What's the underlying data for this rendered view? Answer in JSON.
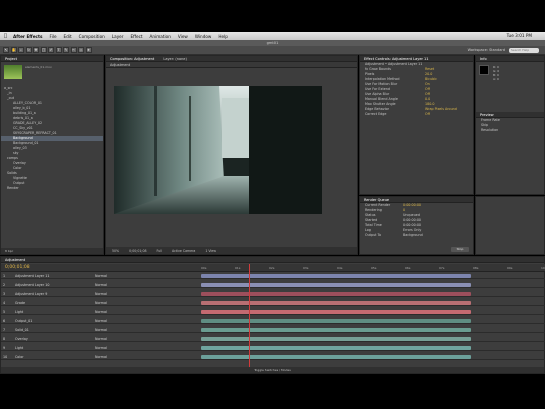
{
  "menubar": {
    "apple": "",
    "app": "After Effects",
    "items": [
      "File",
      "Edit",
      "Composition",
      "Layer",
      "Effect",
      "Animation",
      "View",
      "Window",
      "Help"
    ],
    "clock": "Tue 3:01 PM"
  },
  "window_title": "gmt01",
  "toolbar": {
    "tools": [
      "↖",
      "✋",
      "⌕",
      "↻",
      "✥",
      "□",
      "✐",
      "T",
      "✎",
      "✂",
      "◇",
      "★"
    ],
    "workspace_label": "Workspace:",
    "workspace_value": "Standard",
    "search_placeholder": "Search Help"
  },
  "project": {
    "tab": "Project",
    "folders": [
      "a_src",
      "_in",
      "_out",
      "comps",
      "Solids",
      "Render"
    ],
    "items": [
      "elements_01.mov",
      "ALLEY_COLOR_01",
      "alley_b_01",
      "building_01_a",
      "debris_01_a",
      "GRADE_ALLEY_02",
      "CC_Sky_v01",
      "SKYSCRAPER_REFRACT_01",
      "Background",
      "Background_01",
      "alley_03",
      "sky",
      "Overlay",
      "Color",
      "Vignette",
      "Output"
    ],
    "selected_index": 8,
    "footer": "8 bpc"
  },
  "composition": {
    "tabs": [
      "Composition: Adjustment",
      "Layer: (none)"
    ],
    "subtab": "Adjustment",
    "footer": [
      "50%",
      "0;00;01;08",
      "Full",
      "Active Camera",
      "1 View"
    ]
  },
  "effects": {
    "tab": "Effect Controls: Adjustment Layer 11",
    "rows": [
      {
        "label": "Adjustment • Adjustment Layer 11",
        "value": ""
      },
      {
        "label": "fx Grow Bounds",
        "value": "Reset"
      },
      {
        "label": "Pixels",
        "value": "20.0"
      },
      {
        "label": "Interpolation Method",
        "value": "Bicubic"
      },
      {
        "label": "Use For Motion Blur",
        "value": "On"
      },
      {
        "label": "Use For Extend",
        "value": "Off"
      },
      {
        "label": "Use Alpha Blur",
        "value": "Off"
      },
      {
        "label": "Manual Blend Angle",
        "value": "0.0"
      },
      {
        "label": "Max Shutter Angle",
        "value": "180.0"
      },
      {
        "label": "Edge Behavior",
        "value": "Wrap Pixels Around"
      },
      {
        "label": "Correct Edge",
        "value": "Off"
      }
    ]
  },
  "info": {
    "tab": "Info",
    "values": [
      "R: 0",
      "G: 0",
      "B: 0",
      "A: 0"
    ]
  },
  "preview": {
    "tab": "Preview",
    "values": [
      "Frame Rate",
      "Skip",
      "Resolution"
    ]
  },
  "render_panel": {
    "tab": "Render Queue",
    "rows": [
      {
        "label": "Current Render",
        "value": "0:00:00:00"
      },
      {
        "label": "Rendering",
        "value": "0"
      },
      {
        "label": "Status",
        "value": "Unqueued"
      },
      {
        "label": "Started",
        "value": "0:00:00:00"
      },
      {
        "label": "Total Time",
        "value": "0:00:00:00"
      },
      {
        "label": "Log",
        "value": "Errors Only"
      },
      {
        "label": "Output To",
        "value": "Background"
      }
    ],
    "button": "Stop"
  },
  "timeline": {
    "tab": "Adjustment",
    "timecode": "0;00;01;08",
    "ruler": [
      "00s",
      "01s",
      "02s",
      "03s",
      "04s",
      "05s",
      "06s",
      "07s",
      "08s",
      "09s",
      "10s"
    ],
    "playhead_fraction": 0.14,
    "layers": [
      {
        "num": "1",
        "name": "Adjustment Layer 11",
        "mode": "Normal",
        "color": "#7c84ad"
      },
      {
        "num": "2",
        "name": "Adjustment Layer 10",
        "mode": "Normal",
        "color": "#8a8fb3"
      },
      {
        "num": "3",
        "name": "Adjustment Layer 9",
        "mode": "Normal",
        "color": "#9d4f5c"
      },
      {
        "num": "4",
        "name": "Grade",
        "mode": "Normal",
        "color": "#b76f73"
      },
      {
        "num": "5",
        "name": "Light",
        "mode": "Normal",
        "color": "#c46a71"
      },
      {
        "num": "6",
        "name": "Output_01",
        "mode": "Normal",
        "color": "#5f8d82"
      },
      {
        "num": "7",
        "name": "Solid_01",
        "mode": "Normal",
        "color": "#6a9c90"
      },
      {
        "num": "8",
        "name": "Overlay",
        "mode": "Normal",
        "color": "#769f95"
      },
      {
        "num": "9",
        "name": "Light",
        "mode": "Normal",
        "color": "#6fa49e"
      },
      {
        "num": "10",
        "name": "Color",
        "mode": "Normal",
        "color": "#6ca09a"
      }
    ],
    "footer": "Toggle Switches / Modes"
  }
}
